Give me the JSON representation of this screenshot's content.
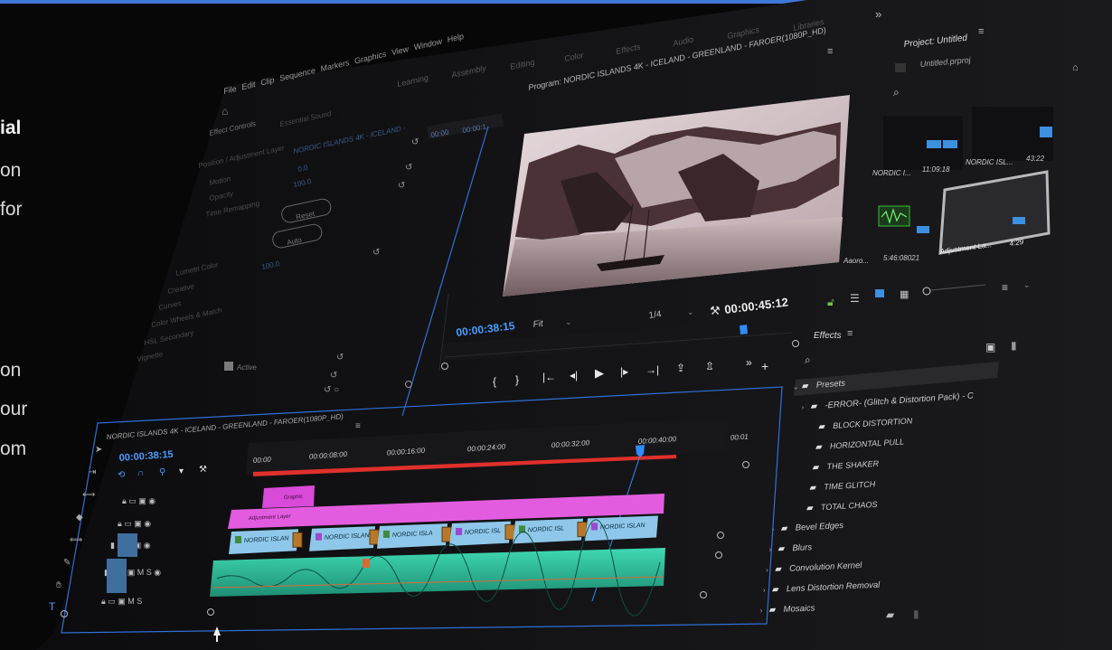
{
  "background_text": [
    "ial",
    "on",
    "for",
    "on",
    "our",
    "om"
  ],
  "menu": [
    "File",
    "Edit",
    "Clip",
    "Sequence",
    "Markers",
    "Graphics",
    "View",
    "Window",
    "Help"
  ],
  "workspaces": [
    "Learning",
    "Assembly",
    "Editing",
    "Color",
    "Effects",
    "Audio",
    "Graphics",
    "Libraries"
  ],
  "effect_controls": {
    "tabs": [
      "Effect Controls",
      "Essential Sound"
    ],
    "clip": "NORDIC ISLANDS 4K - ICELAND -",
    "timecode": "00:00",
    "mini_timecode": "00:00:1",
    "rows": [
      "Position / Adjustment Layer",
      "Motion",
      "Opacity",
      "Time Remapping",
      "Lumetri Color",
      "Creative",
      "Curves",
      "Color Wheels & Match",
      "HSL Secondary",
      "Vignette"
    ],
    "values": [
      "0.0",
      "100.0",
      "100.0"
    ],
    "buttons": [
      "Reset",
      "Auto"
    ],
    "active_label": "Active"
  },
  "program": {
    "title": "Program: NORDIC ISLANDS 4K - ICELAND - GREENLAND - FAROER(1080P_HD)",
    "timecode": "00:00:38:15",
    "fit": "Fit",
    "resolution": "1/4",
    "duration": "00:00:45:12",
    "colors": {
      "accent": "#2f8bff",
      "timecode": "#4a9dff"
    }
  },
  "project": {
    "title": "Project: Untitled",
    "file": "Untitled.prproj",
    "items": [
      {
        "name": "NORDIC I...",
        "duration": "11:09:18"
      },
      {
        "name": "NORDIC ISL...",
        "duration": "43:22"
      },
      {
        "name": "Aaoro...",
        "duration": "5:46:08021"
      },
      {
        "name": "Adjustment La...",
        "duration": "4:29"
      }
    ]
  },
  "effects": {
    "title": "Effects",
    "items": [
      {
        "label": "Presets",
        "level": 0,
        "type": "folder",
        "selected": true
      },
      {
        "label": "-ERROR- (Glitch & Distortion Pack) - C",
        "level": 1,
        "type": "folder"
      },
      {
        "label": "BLOCK DISTORTION",
        "level": 2,
        "type": "preset"
      },
      {
        "label": "HORIZONTAL PULL",
        "level": 2,
        "type": "preset"
      },
      {
        "label": "THE SHAKER",
        "level": 2,
        "type": "preset"
      },
      {
        "label": "TIME GLITCH",
        "level": 2,
        "type": "preset"
      },
      {
        "label": "TOTAL CHAOS",
        "level": 2,
        "type": "preset"
      },
      {
        "label": "Bevel Edges",
        "level": 0,
        "type": "folder"
      },
      {
        "label": "Blurs",
        "level": 0,
        "type": "folder"
      },
      {
        "label": "Convolution Kernel",
        "level": 0,
        "type": "folder"
      },
      {
        "label": "Lens Distortion Removal",
        "level": 0,
        "type": "folder"
      },
      {
        "label": "Mosaics",
        "level": 0,
        "type": "folder"
      }
    ]
  },
  "timeline": {
    "title": "NORDIC ISLANDS 4K - ICELAND - GREENLAND - FAROER(1080P_HD)",
    "timecode": "00:00:38:15",
    "ruler": [
      "00:00",
      "00:00:08:00",
      "00:00:16:00",
      "00:00:24:00",
      "00:00:32:00",
      "00:00:40:00",
      "00:01"
    ],
    "tracks": [
      "V3",
      "V2",
      "V1",
      "A1",
      "A2"
    ],
    "clips": {
      "graphic": "Graphic",
      "adjustment": "Adjustment Layer",
      "video": [
        "NORDIC ISLAN",
        "NORDIC ISLAN",
        "NORDIC ISLA",
        "NORDIC ISL",
        "NORDIC ISL",
        "NORDIC ISLAN"
      ]
    },
    "colors": {
      "graphic": "#d94ad9",
      "adjustment": "#e35ce0",
      "video": "#8ec7ea",
      "audio": "#2bbf9c",
      "playhead": "#2f8bff",
      "workarea": "#e0302b"
    }
  }
}
